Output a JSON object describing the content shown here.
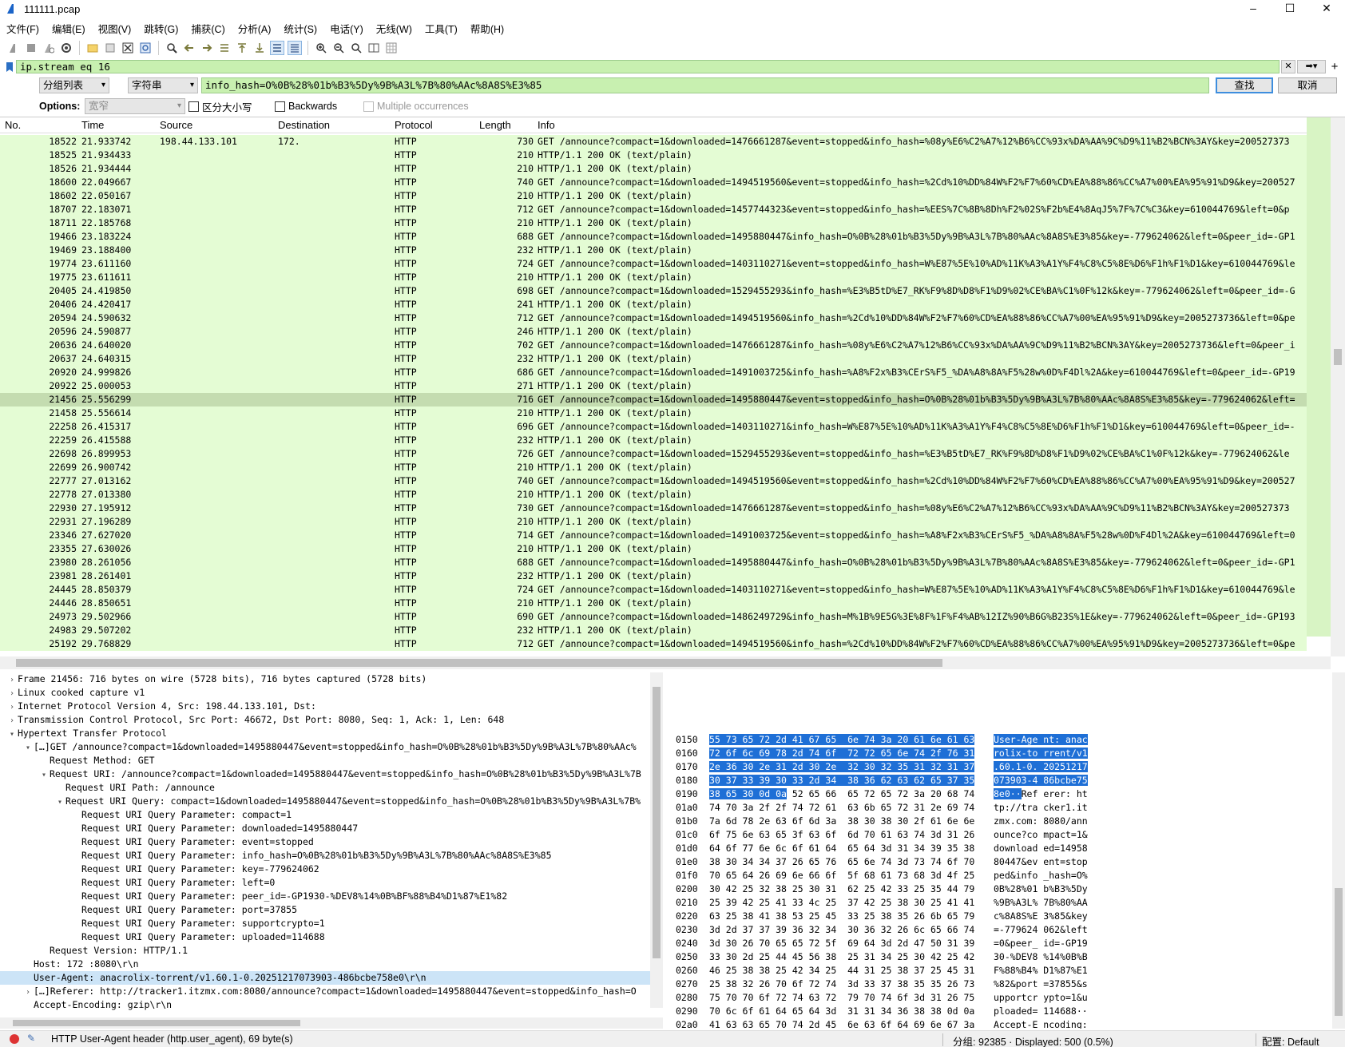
{
  "window": {
    "title": "111111.pcap",
    "minimize": "–",
    "maximize": "☐",
    "close": "✕"
  },
  "menu": [
    "文件(F)",
    "编辑(E)",
    "视图(V)",
    "跳转(G)",
    "捕获(C)",
    "分析(A)",
    "统计(S)",
    "电话(Y)",
    "无线(W)",
    "工具(T)",
    "帮助(H)"
  ],
  "toolbar_icons": [
    "shark-fin-icon",
    "stop-icon",
    "restart-icon",
    "options-gear-icon",
    "open-folder-icon",
    "save-file-icon",
    "close-file-icon",
    "reload-icon",
    "find-icon",
    "back-arrow-icon",
    "forward-arrow-icon",
    "goto-packet-icon",
    "first-packet-icon",
    "last-packet-icon",
    "autoscroll-icon",
    "colorize-icon",
    "zoom-in-icon",
    "zoom-out-icon",
    "zoom-normal-icon",
    "resize-columns-icon",
    "layout-icon"
  ],
  "display_filter": {
    "value": "ip.stream eq 16",
    "plus": "+"
  },
  "find": {
    "search_in": "分组列表",
    "search_type": "字符串",
    "value": "info_hash=O%0B%28%01b%B3%5Dy%9B%A3L%7B%80%AAc%8A8S%E3%85",
    "find_button": "查找",
    "cancel_button": "取消"
  },
  "options": {
    "label": "Options:",
    "charset": "宽窄",
    "case_sensitive": "区分大小写",
    "backwards": "Backwards",
    "multiple": "Multiple occurrences"
  },
  "packet_list": {
    "columns": [
      "No.",
      "Time",
      "Source",
      "Destination",
      "Protocol",
      "Length",
      "Info"
    ],
    "rows": [
      {
        "no": "18522",
        "time": "21.933742",
        "src": "198.44.133.101",
        "dst": "172.",
        "proto": "HTTP",
        "len": "730",
        "info": "GET /announce?compact=1&downloaded=1476661287&event=stopped&info_hash=%08y%E6%C2%A7%12%B6%CC%93x%DA%AA%9C%D9%11%B2%BCN%3AY&key=200527373"
      },
      {
        "no": "18525",
        "time": "21.934433",
        "src": "",
        "dst": "",
        "proto": "HTTP",
        "len": "210",
        "info": "HTTP/1.1 200 OK  (text/plain)"
      },
      {
        "no": "18526",
        "time": "21.934444",
        "src": "",
        "dst": "",
        "proto": "HTTP",
        "len": "210",
        "info": "HTTP/1.1 200 OK  (text/plain)"
      },
      {
        "no": "18600",
        "time": "22.049667",
        "src": "",
        "dst": "",
        "proto": "HTTP",
        "len": "740",
        "info": "GET /announce?compact=1&downloaded=1494519560&event=stopped&info_hash=%2Cd%10%DD%84W%F2%F7%60%CD%EA%88%86%CC%A7%00%EA%95%91%D9&key=200527"
      },
      {
        "no": "18602",
        "time": "22.050167",
        "src": "",
        "dst": "",
        "proto": "HTTP",
        "len": "210",
        "info": "HTTP/1.1 200 OK  (text/plain)"
      },
      {
        "no": "18707",
        "time": "22.183071",
        "src": "",
        "dst": "",
        "proto": "HTTP",
        "len": "712",
        "info": "GET /announce?compact=1&downloaded=1457744323&event=stopped&info_hash=%EES%7C%8B%8Dh%F2%02S%F2b%E4%8AqJ5%7F%7C%C3&key=610044769&left=0&p"
      },
      {
        "no": "18711",
        "time": "22.185768",
        "src": "",
        "dst": "",
        "proto": "HTTP",
        "len": "210",
        "info": "HTTP/1.1 200 OK  (text/plain)"
      },
      {
        "no": "19466",
        "time": "23.183224",
        "src": "",
        "dst": "",
        "proto": "HTTP",
        "len": "688",
        "info": "GET /announce?compact=1&downloaded=1495880447&info_hash=O%0B%28%01b%B3%5Dy%9B%A3L%7B%80%AAc%8A8S%E3%85&key=-779624062&left=0&peer_id=-GP1"
      },
      {
        "no": "19469",
        "time": "23.188400",
        "src": "",
        "dst": "",
        "proto": "HTTP",
        "len": "232",
        "info": "HTTP/1.1 200 OK  (text/plain)"
      },
      {
        "no": "19774",
        "time": "23.611160",
        "src": "",
        "dst": "",
        "proto": "HTTP",
        "len": "724",
        "info": "GET /announce?compact=1&downloaded=1403110271&event=stopped&info_hash=W%E87%5E%10%AD%11K%A3%A1Y%F4%C8%C5%8E%D6%F1h%F1%D1&key=610044769&le"
      },
      {
        "no": "19775",
        "time": "23.611611",
        "src": "",
        "dst": "",
        "proto": "HTTP",
        "len": "210",
        "info": "HTTP/1.1 200 OK  (text/plain)"
      },
      {
        "no": "20405",
        "time": "24.419850",
        "src": "",
        "dst": "",
        "proto": "HTTP",
        "len": "698",
        "info": "GET /announce?compact=1&downloaded=1529455293&info_hash=%E3%B5tD%E7_RK%F9%8D%D8%F1%D9%02%CE%BA%C1%0F%12k&key=-779624062&left=0&peer_id=-G"
      },
      {
        "no": "20406",
        "time": "24.420417",
        "src": "",
        "dst": "",
        "proto": "HTTP",
        "len": "241",
        "info": "HTTP/1.1 200 OK  (text/plain)"
      },
      {
        "no": "20594",
        "time": "24.590632",
        "src": "",
        "dst": "",
        "proto": "HTTP",
        "len": "712",
        "info": "GET /announce?compact=1&downloaded=1494519560&info_hash=%2Cd%10%DD%84W%F2%F7%60%CD%EA%88%86%CC%A7%00%EA%95%91%D9&key=2005273736&left=0&pe"
      },
      {
        "no": "20596",
        "time": "24.590877",
        "src": "",
        "dst": "",
        "proto": "HTTP",
        "len": "246",
        "info": "HTTP/1.1 200 OK  (text/plain)"
      },
      {
        "no": "20636",
        "time": "24.640020",
        "src": "",
        "dst": "",
        "proto": "HTTP",
        "len": "702",
        "info": "GET /announce?compact=1&downloaded=1476661287&info_hash=%08y%E6%C2%A7%12%B6%CC%93x%DA%AA%9C%D9%11%B2%BCN%3AY&key=2005273736&left=0&peer_i"
      },
      {
        "no": "20637",
        "time": "24.640315",
        "src": "",
        "dst": "",
        "proto": "HTTP",
        "len": "232",
        "info": "HTTP/1.1 200 OK  (text/plain)"
      },
      {
        "no": "20920",
        "time": "24.999826",
        "src": "",
        "dst": "",
        "proto": "HTTP",
        "len": "686",
        "info": "GET /announce?compact=1&downloaded=1491003725&info_hash=%A8%F2x%B3%CErS%F5_%DA%A8%8A%F5%28w%0D%F4Dl%2A&key=610044769&left=0&peer_id=-GP19"
      },
      {
        "no": "20922",
        "time": "25.000053",
        "src": "",
        "dst": "",
        "proto": "HTTP",
        "len": "271",
        "info": "HTTP/1.1 200 OK  (text/plain)"
      },
      {
        "no": "21456",
        "time": "25.556299",
        "src": "",
        "dst": "",
        "proto": "HTTP",
        "len": "716",
        "info": "GET /announce?compact=1&downloaded=1495880447&event=stopped&info_hash=O%0B%28%01b%B3%5Dy%9B%A3L%7B%80%AAc%8A8S%E3%85&key=-779624062&left=",
        "selected": true
      },
      {
        "no": "21458",
        "time": "25.556614",
        "src": "",
        "dst": "",
        "proto": "HTTP",
        "len": "210",
        "info": "HTTP/1.1 200 OK  (text/plain)"
      },
      {
        "no": "22258",
        "time": "26.415317",
        "src": "",
        "dst": "",
        "proto": "HTTP",
        "len": "696",
        "info": "GET /announce?compact=1&downloaded=1403110271&info_hash=W%E87%5E%10%AD%11K%A3%A1Y%F4%C8%C5%8E%D6%F1h%F1%D1&key=610044769&left=0&peer_id=-"
      },
      {
        "no": "22259",
        "time": "26.415588",
        "src": "",
        "dst": "",
        "proto": "HTTP",
        "len": "232",
        "info": "HTTP/1.1 200 OK  (text/plain)"
      },
      {
        "no": "22698",
        "time": "26.899953",
        "src": "",
        "dst": "",
        "proto": "HTTP",
        "len": "726",
        "info": "GET /announce?compact=1&downloaded=1529455293&event=stopped&info_hash=%E3%B5tD%E7_RK%F9%8D%D8%F1%D9%02%CE%BA%C1%0F%12k&key=-779624062&le"
      },
      {
        "no": "22699",
        "time": "26.900742",
        "src": "",
        "dst": "",
        "proto": "HTTP",
        "len": "210",
        "info": "HTTP/1.1 200 OK  (text/plain)"
      },
      {
        "no": "22777",
        "time": "27.013162",
        "src": "",
        "dst": "",
        "proto": "HTTP",
        "len": "740",
        "info": "GET /announce?compact=1&downloaded=1494519560&event=stopped&info_hash=%2Cd%10%DD%84W%F2%F7%60%CD%EA%88%86%CC%A7%00%EA%95%91%D9&key=200527"
      },
      {
        "no": "22778",
        "time": "27.013380",
        "src": "",
        "dst": "",
        "proto": "HTTP",
        "len": "210",
        "info": "HTTP/1.1 200 OK  (text/plain)"
      },
      {
        "no": "22930",
        "time": "27.195912",
        "src": "",
        "dst": "",
        "proto": "HTTP",
        "len": "730",
        "info": "GET /announce?compact=1&downloaded=1476661287&event=stopped&info_hash=%08y%E6%C2%A7%12%B6%CC%93x%DA%AA%9C%D9%11%B2%BCN%3AY&key=200527373"
      },
      {
        "no": "22931",
        "time": "27.196289",
        "src": "",
        "dst": "",
        "proto": "HTTP",
        "len": "210",
        "info": "HTTP/1.1 200 OK  (text/plain)"
      },
      {
        "no": "23346",
        "time": "27.627020",
        "src": "",
        "dst": "",
        "proto": "HTTP",
        "len": "714",
        "info": "GET /announce?compact=1&downloaded=1491003725&event=stopped&info_hash=%A8%F2x%B3%CErS%F5_%DA%A8%8A%F5%28w%0D%F4Dl%2A&key=610044769&left=0"
      },
      {
        "no": "23355",
        "time": "27.630026",
        "src": "",
        "dst": "",
        "proto": "HTTP",
        "len": "210",
        "info": "HTTP/1.1 200 OK  (text/plain)"
      },
      {
        "no": "23980",
        "time": "28.261056",
        "src": "",
        "dst": "",
        "proto": "HTTP",
        "len": "688",
        "info": "GET /announce?compact=1&downloaded=1495880447&info_hash=O%0B%28%01b%B3%5Dy%9B%A3L%7B%80%AAc%8A8S%E3%85&key=-779624062&left=0&peer_id=-GP1"
      },
      {
        "no": "23981",
        "time": "28.261401",
        "src": "",
        "dst": "",
        "proto": "HTTP",
        "len": "232",
        "info": "HTTP/1.1 200 OK  (text/plain)"
      },
      {
        "no": "24445",
        "time": "28.850379",
        "src": "",
        "dst": "",
        "proto": "HTTP",
        "len": "724",
        "info": "GET /announce?compact=1&downloaded=1403110271&event=stopped&info_hash=W%E87%5E%10%AD%11K%A3%A1Y%F4%C8%C5%8E%D6%F1h%F1%D1&key=610044769&le"
      },
      {
        "no": "24446",
        "time": "28.850651",
        "src": "",
        "dst": "",
        "proto": "HTTP",
        "len": "210",
        "info": "HTTP/1.1 200 OK  (text/plain)"
      },
      {
        "no": "24973",
        "time": "29.502966",
        "src": "",
        "dst": "",
        "proto": "HTTP",
        "len": "690",
        "info": "GET /announce?compact=1&downloaded=1486249729&info_hash=M%1B%9E5G%3E%8F%1F%F4%AB%12IZ%90%B6G%B23S%1E&key=-779624062&left=0&peer_id=-GP193"
      },
      {
        "no": "24983",
        "time": "29.507202",
        "src": "",
        "dst": "",
        "proto": "HTTP",
        "len": "232",
        "info": "HTTP/1.1 200 OK  (text/plain)"
      },
      {
        "no": "25192",
        "time": "29.768829",
        "src": "",
        "dst": "",
        "proto": "HTTP",
        "len": "712",
        "info": "GET /announce?compact=1&downloaded=1494519560&info_hash=%2Cd%10%DD%84W%F2%F7%60%CD%EA%88%86%CC%A7%00%EA%95%91%D9&key=2005273736&left=0&pe"
      }
    ]
  },
  "details": [
    {
      "t": ">",
      "indent": 0,
      "text": "Frame 21456: 716 bytes on wire (5728 bits), 716 bytes captured (5728 bits)"
    },
    {
      "t": ">",
      "indent": 0,
      "text": "Linux cooked capture v1"
    },
    {
      "t": ">",
      "indent": 0,
      "text": "Internet Protocol Version 4, Src: 198.44.133.101, Dst:"
    },
    {
      "t": ">",
      "indent": 0,
      "text": "Transmission Control Protocol, Src Port: 46672, Dst Port: 8080, Seq: 1, Ack: 1, Len: 648"
    },
    {
      "t": "v",
      "indent": 0,
      "text": "Hypertext Transfer Protocol"
    },
    {
      "t": "v",
      "indent": 1,
      "text": "[…]GET /announce?compact=1&downloaded=1495880447&event=stopped&info_hash=O%0B%28%01b%B3%5Dy%9B%A3L%7B%80%AAc%"
    },
    {
      "t": "",
      "indent": 2,
      "text": "Request Method: GET"
    },
    {
      "t": "v",
      "indent": 2,
      "text": "Request URI: /announce?compact=1&downloaded=1495880447&event=stopped&info_hash=O%0B%28%01b%B3%5Dy%9B%A3L%7B"
    },
    {
      "t": "",
      "indent": 3,
      "text": "Request URI Path: /announce"
    },
    {
      "t": "v",
      "indent": 3,
      "text": "Request URI Query: compact=1&downloaded=1495880447&event=stopped&info_hash=O%0B%28%01b%B3%5Dy%9B%A3L%7B%"
    },
    {
      "t": "",
      "indent": 4,
      "text": "Request URI Query Parameter: compact=1"
    },
    {
      "t": "",
      "indent": 4,
      "text": "Request URI Query Parameter: downloaded=1495880447"
    },
    {
      "t": "",
      "indent": 4,
      "text": "Request URI Query Parameter: event=stopped"
    },
    {
      "t": "",
      "indent": 4,
      "text": "Request URI Query Parameter: info_hash=O%0B%28%01b%B3%5Dy%9B%A3L%7B%80%AAc%8A8S%E3%85"
    },
    {
      "t": "",
      "indent": 4,
      "text": "Request URI Query Parameter: key=-779624062"
    },
    {
      "t": "",
      "indent": 4,
      "text": "Request URI Query Parameter: left=0"
    },
    {
      "t": "",
      "indent": 4,
      "text": "Request URI Query Parameter: peer_id=-GP1930-%DEV8%14%0B%BF%88%B4%D1%87%E1%82"
    },
    {
      "t": "",
      "indent": 4,
      "text": "Request URI Query Parameter: port=37855"
    },
    {
      "t": "",
      "indent": 4,
      "text": "Request URI Query Parameter: supportcrypto=1"
    },
    {
      "t": "",
      "indent": 4,
      "text": "Request URI Query Parameter: uploaded=114688"
    },
    {
      "t": "",
      "indent": 2,
      "text": "Request Version: HTTP/1.1"
    },
    {
      "t": "",
      "indent": 1,
      "text": "Host: 172          :8080\\r\\n"
    },
    {
      "t": "",
      "indent": 1,
      "text": "User-Agent: anacrolix-torrent/v1.60.1-0.20251217073903-486bcbe758e0\\r\\n",
      "selected": true
    },
    {
      "t": ">",
      "indent": 1,
      "text": "[…]Referer: http://tracker1.itzmx.com:8080/announce?compact=1&downloaded=1495880447&event=stopped&info_hash=O"
    },
    {
      "t": "",
      "indent": 1,
      "text": "Accept-Encoding: gzip\\r\\n"
    }
  ],
  "bytes": [
    {
      "off": "0150",
      "hl": "55 73 65 72 2d 41 67 65  6e 74 3a 20 61 6e 61 63",
      "hx": "",
      "ahl": "User-Age nt: anac",
      "asc": ""
    },
    {
      "off": "0160",
      "hl": "72 6f 6c 69 78 2d 74 6f  72 72 65 6e 74 2f 76 31",
      "hx": "",
      "ahl": "rolix-to rrent/v1",
      "asc": ""
    },
    {
      "off": "0170",
      "hl": "2e 36 30 2e 31 2d 30 2e  32 30 32 35 31 32 31 37",
      "hx": "",
      "ahl": ".60.1-0. 20251217",
      "asc": ""
    },
    {
      "off": "0180",
      "hl": "30 37 33 39 30 33 2d 34  38 36 62 63 62 65 37 35",
      "hx": "",
      "ahl": "073903-4 86bcbe75",
      "asc": ""
    },
    {
      "off": "0190",
      "hl": "38 65 30 0d 0a",
      "hx": " 52 65 66  65 72 65 72 3a 20 68 74",
      "ahl": "8e0··",
      "asc": "Ref erer: ht"
    },
    {
      "off": "01a0",
      "hl": "",
      "hx": "74 70 3a 2f 2f 74 72 61  63 6b 65 72 31 2e 69 74",
      "ahl": "",
      "asc": "tp://tra cker1.it"
    },
    {
      "off": "01b0",
      "hl": "",
      "hx": "7a 6d 78 2e 63 6f 6d 3a  38 30 38 30 2f 61 6e 6e",
      "ahl": "",
      "asc": "zmx.com: 8080/ann"
    },
    {
      "off": "01c0",
      "hl": "",
      "hx": "6f 75 6e 63 65 3f 63 6f  6d 70 61 63 74 3d 31 26",
      "ahl": "",
      "asc": "ounce?co mpact=1&"
    },
    {
      "off": "01d0",
      "hl": "",
      "hx": "64 6f 77 6e 6c 6f 61 64  65 64 3d 31 34 39 35 38",
      "ahl": "",
      "asc": "download ed=14958"
    },
    {
      "off": "01e0",
      "hl": "",
      "hx": "38 30 34 34 37 26 65 76  65 6e 74 3d 73 74 6f 70",
      "ahl": "",
      "asc": "80447&ev ent=stop"
    },
    {
      "off": "01f0",
      "hl": "",
      "hx": "70 65 64 26 69 6e 66 6f  5f 68 61 73 68 3d 4f 25",
      "ahl": "",
      "asc": "ped&info _hash=O%"
    },
    {
      "off": "0200",
      "hl": "",
      "hx": "30 42 25 32 38 25 30 31  62 25 42 33 25 35 44 79",
      "ahl": "",
      "asc": "0B%28%01 b%B3%5Dy"
    },
    {
      "off": "0210",
      "hl": "",
      "hx": "25 39 42 25 41 33 4c 25  37 42 25 38 30 25 41 41",
      "ahl": "",
      "asc": "%9B%A3L% 7B%80%AA"
    },
    {
      "off": "0220",
      "hl": "",
      "hx": "63 25 38 41 38 53 25 45  33 25 38 35 26 6b 65 79",
      "ahl": "",
      "asc": "c%8A8S%E 3%85&key"
    },
    {
      "off": "0230",
      "hl": "",
      "hx": "3d 2d 37 37 39 36 32 34  30 36 32 26 6c 65 66 74",
      "ahl": "",
      "asc": "=-779624 062&left"
    },
    {
      "off": "0240",
      "hl": "",
      "hx": "3d 30 26 70 65 65 72 5f  69 64 3d 2d 47 50 31 39",
      "ahl": "",
      "asc": "=0&peer_ id=-GP19"
    },
    {
      "off": "0250",
      "hl": "",
      "hx": "33 30 2d 25 44 45 56 38  25 31 34 25 30 42 25 42",
      "ahl": "",
      "asc": "30-%DEV8 %14%0B%B"
    },
    {
      "off": "0260",
      "hl": "",
      "hx": "46 25 38 38 25 42 34 25  44 31 25 38 37 25 45 31",
      "ahl": "",
      "asc": "F%88%B4% D1%87%E1"
    },
    {
      "off": "0270",
      "hl": "",
      "hx": "25 38 32 26 70 6f 72 74  3d 33 37 38 35 35 26 73",
      "ahl": "",
      "asc": "%82&port =37855&s"
    },
    {
      "off": "0280",
      "hl": "",
      "hx": "75 70 70 6f 72 74 63 72  79 70 74 6f 3d 31 26 75",
      "ahl": "",
      "asc": "upportcr ypto=1&u"
    },
    {
      "off": "0290",
      "hl": "",
      "hx": "70 6c 6f 61 64 65 64 3d  31 31 34 36 38 38 0d 0a",
      "ahl": "",
      "asc": "ploaded= 114688··"
    },
    {
      "off": "02a0",
      "hl": "",
      "hx": "41 63 63 65 70 74 2d 45  6e 63 6f 64 69 6e 67 3a",
      "ahl": "",
      "asc": "Accept-E ncoding:"
    },
    {
      "off": "02b0",
      "hl": "",
      "hx": "20 67 7a 69 70 0d 0a 43  6f 6e 6e 65 63 74 69 6f",
      "ahl": "",
      "asc": " gzip··C onnectio"
    },
    {
      "off": "02c0",
      "hl": "",
      "hx": "6e 3a 20 63 6c 6f 73 65  0d 0a 0d 0a",
      "ahl": "",
      "asc": "n: close ····"
    }
  ],
  "status": {
    "field_info": "HTTP User-Agent header (http.user_agent), 69 byte(s)",
    "packets": "分组: 92385 · Displayed: 500 (0.5%)",
    "profile": "配置: Default"
  },
  "colors": {
    "http_row": "#e4fcd4",
    "selected_row": "#c4dcb0",
    "filter_ok": "#c8f0b0",
    "byte_highlight": "#1e6fd6"
  }
}
